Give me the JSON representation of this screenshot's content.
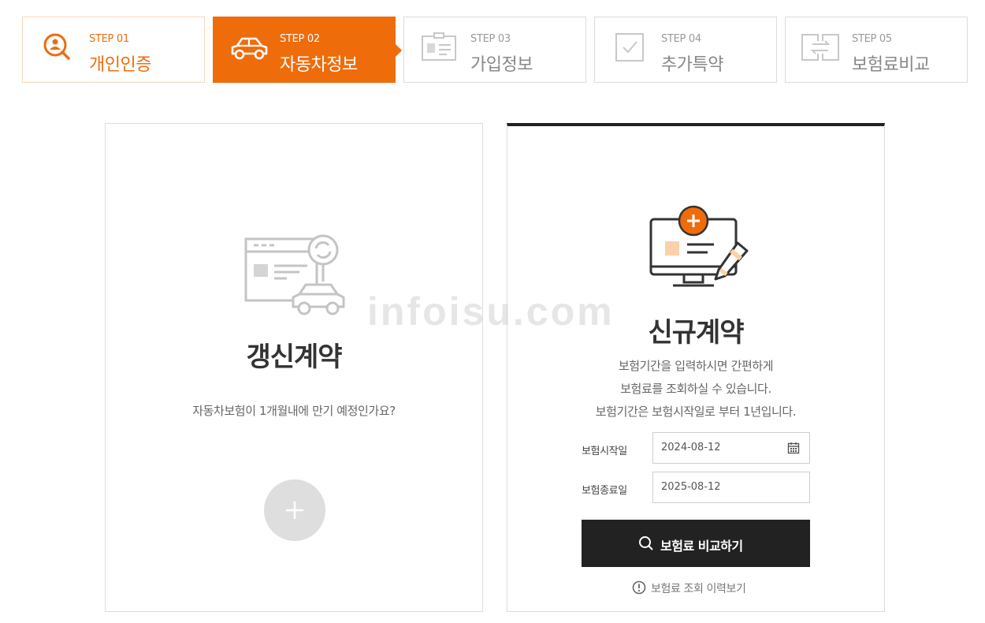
{
  "steps": [
    {
      "num": "STEP 01",
      "name": "개인인증",
      "icon": "person-search-icon",
      "state": "done"
    },
    {
      "num": "STEP 02",
      "name": "자동차정보",
      "icon": "car-icon",
      "state": "active"
    },
    {
      "num": "STEP 03",
      "name": "가입정보",
      "icon": "id-card-icon",
      "state": "pending"
    },
    {
      "num": "STEP 04",
      "name": "추가특약",
      "icon": "checkbox-icon",
      "state": "pending"
    },
    {
      "num": "STEP 05",
      "name": "보험료비교",
      "icon": "compare-arrows-icon",
      "state": "pending"
    }
  ],
  "renew": {
    "title": "갱신계약",
    "desc": "자동차보험이 1개월내에 만기 예정인가요?"
  },
  "new_contract": {
    "title": "신규계약",
    "desc_lines": [
      "보험기간을 입력하시면 간편하게",
      "보험료를 조회하실 수 있습니다.",
      "보험기간은 보험시작일로 부터 1년입니다."
    ],
    "start_label": "보험시작일",
    "start_value": "2024-08-12",
    "end_label": "보험종료일",
    "end_value": "2025-08-12",
    "compare_button": "보험료 비교하기",
    "history_link": "보험료 조회 이력보기"
  },
  "watermark": "infoisu.com",
  "colors": {
    "accent": "#ef6c0b",
    "dark": "#222222",
    "border": "#dcdcdc"
  }
}
